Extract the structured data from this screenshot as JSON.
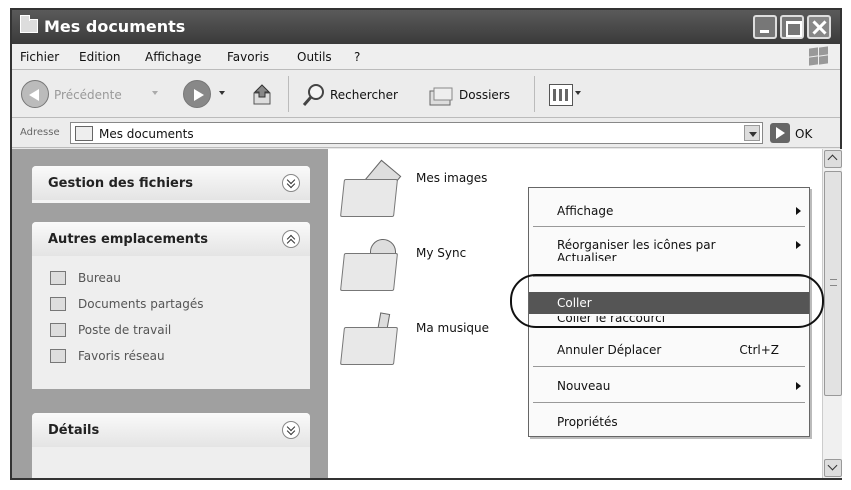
{
  "window": {
    "title": "Mes documents"
  },
  "menu": [
    "Fichier",
    "Edition",
    "Affichage",
    "Favoris",
    "Outils",
    "?"
  ],
  "toolbar": {
    "back_label": "Précédente",
    "search_label": "Rechercher",
    "folders_label": "Dossiers"
  },
  "address": {
    "label": "Adresse",
    "value": "Mes documents",
    "go_label": "OK"
  },
  "panels": {
    "files": {
      "title": "Gestion des fichiers"
    },
    "places": {
      "title": "Autres emplacements",
      "items": [
        "Bureau",
        "Documents partagés",
        "Poste de travail",
        "Favoris réseau"
      ]
    },
    "details": {
      "title": "Détails"
    }
  },
  "folders": [
    "Mes images",
    "My Sync",
    "Ma musique"
  ],
  "context_menu": {
    "items": [
      {
        "label": "Affichage",
        "submenu": true
      },
      {
        "label": "Réorganiser les icônes par",
        "submenu": true
      },
      {
        "label": "Actualiser"
      },
      {
        "label": "Coller",
        "highlighted": true
      },
      {
        "label": "Coller le raccourci"
      },
      {
        "label": "Annuler Déplacer",
        "shortcut": "Ctrl+Z"
      },
      {
        "label": "Nouveau",
        "submenu": true
      },
      {
        "label": "Propriétés"
      }
    ]
  }
}
